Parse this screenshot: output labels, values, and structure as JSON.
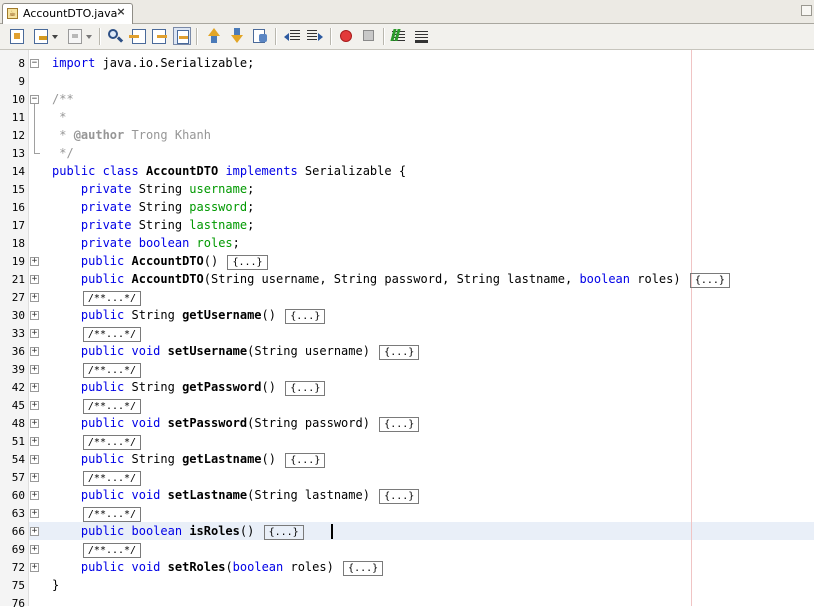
{
  "tab": {
    "title": "AccountDTO.java",
    "icon": "java-file-icon",
    "close": "×"
  },
  "toolbar": {
    "buttons": [
      "last-edit-icon",
      "back-icon",
      "forward-icon",
      "find-selection-icon",
      "find-previous-icon",
      "find-next-icon",
      "toggle-highlight-icon",
      "previous-bookmark-icon",
      "next-bookmark-icon",
      "toggle-bookmark-icon",
      "shift-left-icon",
      "shift-right-icon",
      "start-macro-icon",
      "stop-macro-icon",
      "comment-icon",
      "uncomment-icon"
    ]
  },
  "editor": {
    "lines": [
      {
        "num": "8",
        "fold": "−",
        "code": "import java.io.Serializable;"
      },
      {
        "num": "9",
        "fold": "",
        "code": ""
      },
      {
        "num": "10",
        "fold": "−",
        "code": "/**"
      },
      {
        "num": "11",
        "fold": "",
        "code": " *"
      },
      {
        "num": "12",
        "fold": "",
        "code": " * @author Trong Khanh"
      },
      {
        "num": "13",
        "fold": "",
        "code": " */"
      },
      {
        "num": "14",
        "fold": "",
        "code": "public class AccountDTO implements Serializable {"
      },
      {
        "num": "15",
        "fold": "",
        "code": "    private String username;"
      },
      {
        "num": "16",
        "fold": "",
        "code": "    private String password;"
      },
      {
        "num": "17",
        "fold": "",
        "code": "    private String lastname;"
      },
      {
        "num": "18",
        "fold": "",
        "code": "    private boolean roles;"
      },
      {
        "num": "19",
        "fold": "+",
        "code": "    public AccountDTO() {...}"
      },
      {
        "num": "21",
        "fold": "+",
        "code": "    public AccountDTO(String username, String password, String lastname, boolean roles) {...}"
      },
      {
        "num": "27",
        "fold": "+",
        "code": "    /**...*/"
      },
      {
        "num": "30",
        "fold": "+",
        "code": "    public String getUsername() {...}"
      },
      {
        "num": "33",
        "fold": "+",
        "code": "    /**...*/"
      },
      {
        "num": "36",
        "fold": "+",
        "code": "    public void setUsername(String username) {...}"
      },
      {
        "num": "39",
        "fold": "+",
        "code": "    /**...*/"
      },
      {
        "num": "42",
        "fold": "+",
        "code": "    public String getPassword() {...}"
      },
      {
        "num": "45",
        "fold": "+",
        "code": "    /**...*/"
      },
      {
        "num": "48",
        "fold": "+",
        "code": "    public void setPassword(String password) {...}"
      },
      {
        "num": "51",
        "fold": "+",
        "code": "    /**...*/"
      },
      {
        "num": "54",
        "fold": "+",
        "code": "    public String getLastname() {...}"
      },
      {
        "num": "57",
        "fold": "+",
        "code": "    /**...*/"
      },
      {
        "num": "60",
        "fold": "+",
        "code": "    public void setLastname(String lastname) {...}"
      },
      {
        "num": "63",
        "fold": "+",
        "code": "    /**...*/"
      },
      {
        "num": "66",
        "fold": "+",
        "code": "    public boolean isRoles() {...}"
      },
      {
        "num": "69",
        "fold": "+",
        "code": "    /**...*/"
      },
      {
        "num": "72",
        "fold": "+",
        "code": "    public void setRoles(boolean roles) {...}"
      },
      {
        "num": "75",
        "fold": "",
        "code": "}"
      },
      {
        "num": "76",
        "fold": "",
        "code": ""
      }
    ],
    "current_line": "66",
    "colors": {
      "keyword": "#0000e6",
      "field": "#009900",
      "comment": "#969696",
      "current_line": "#e9eff8",
      "right_margin": "#f0c4c4"
    }
  }
}
